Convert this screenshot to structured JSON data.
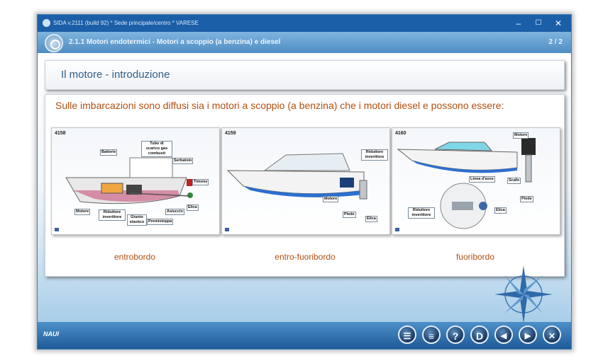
{
  "window": {
    "title": "SIDA v.2111 (build 92) * Sede principale/centro * VARESE",
    "minimize_icon": "minimize-icon",
    "maximize_icon": "maximize-icon",
    "close_icon": "close-icon"
  },
  "header": {
    "title": "2.1.1 Motori endotermici - Motori a scoppio (a benzina) e diesel",
    "page_counter": "2 / 2"
  },
  "section": {
    "title": "Il motore - introduzione"
  },
  "content": {
    "intro": "Sulle imbarcazioni sono diffusi sia i motori a scoppio (a benzina) che i motori diesel e possono essere:",
    "figures": [
      {
        "number": "4158",
        "caption": "entrobordo",
        "labels": {
          "batterie": "Batterie",
          "tubo": "Tubo di scarico gas combusti",
          "serbatoio": "Serbatoio",
          "timone": "Timone",
          "motore": "Motore",
          "riduttore": "Riduttore invertitore",
          "giunto": "Giunto elastico",
          "premistoppa": "Premistoppa",
          "asiuccio": "Asiuccio",
          "elica": "Elica"
        }
      },
      {
        "number": "4159",
        "caption": "entro-fuoribordo",
        "labels": {
          "riduttore": "Riduttore invertitore",
          "motore": "Motore",
          "piede": "Piede",
          "elica": "Elica"
        }
      },
      {
        "number": "4160",
        "caption": "fuoribordo",
        "labels": {
          "motore": "Motore",
          "scafo": "Scafo",
          "piede": "Piede",
          "linea": "Linea d'asse",
          "riduttore": "Riduttore invertitore",
          "elica": "Elica"
        }
      }
    ]
  },
  "footer": {
    "logo": "NAUI",
    "buttons": [
      {
        "icon": "index-icon",
        "label": "☰"
      },
      {
        "icon": "list-icon",
        "label": "≡"
      },
      {
        "icon": "help-icon",
        "label": "?"
      },
      {
        "icon": "d-icon",
        "label": "D"
      },
      {
        "icon": "previous-icon",
        "label": "◀"
      },
      {
        "icon": "next-icon",
        "label": "▶"
      },
      {
        "icon": "close-icon",
        "label": "✕"
      }
    ]
  },
  "colors": {
    "titlebar": "#1b5fa8",
    "header": "#5a97cc",
    "accent_text": "#b24f10",
    "section_title": "#2f5e86",
    "footer": "#2a6aa8"
  }
}
